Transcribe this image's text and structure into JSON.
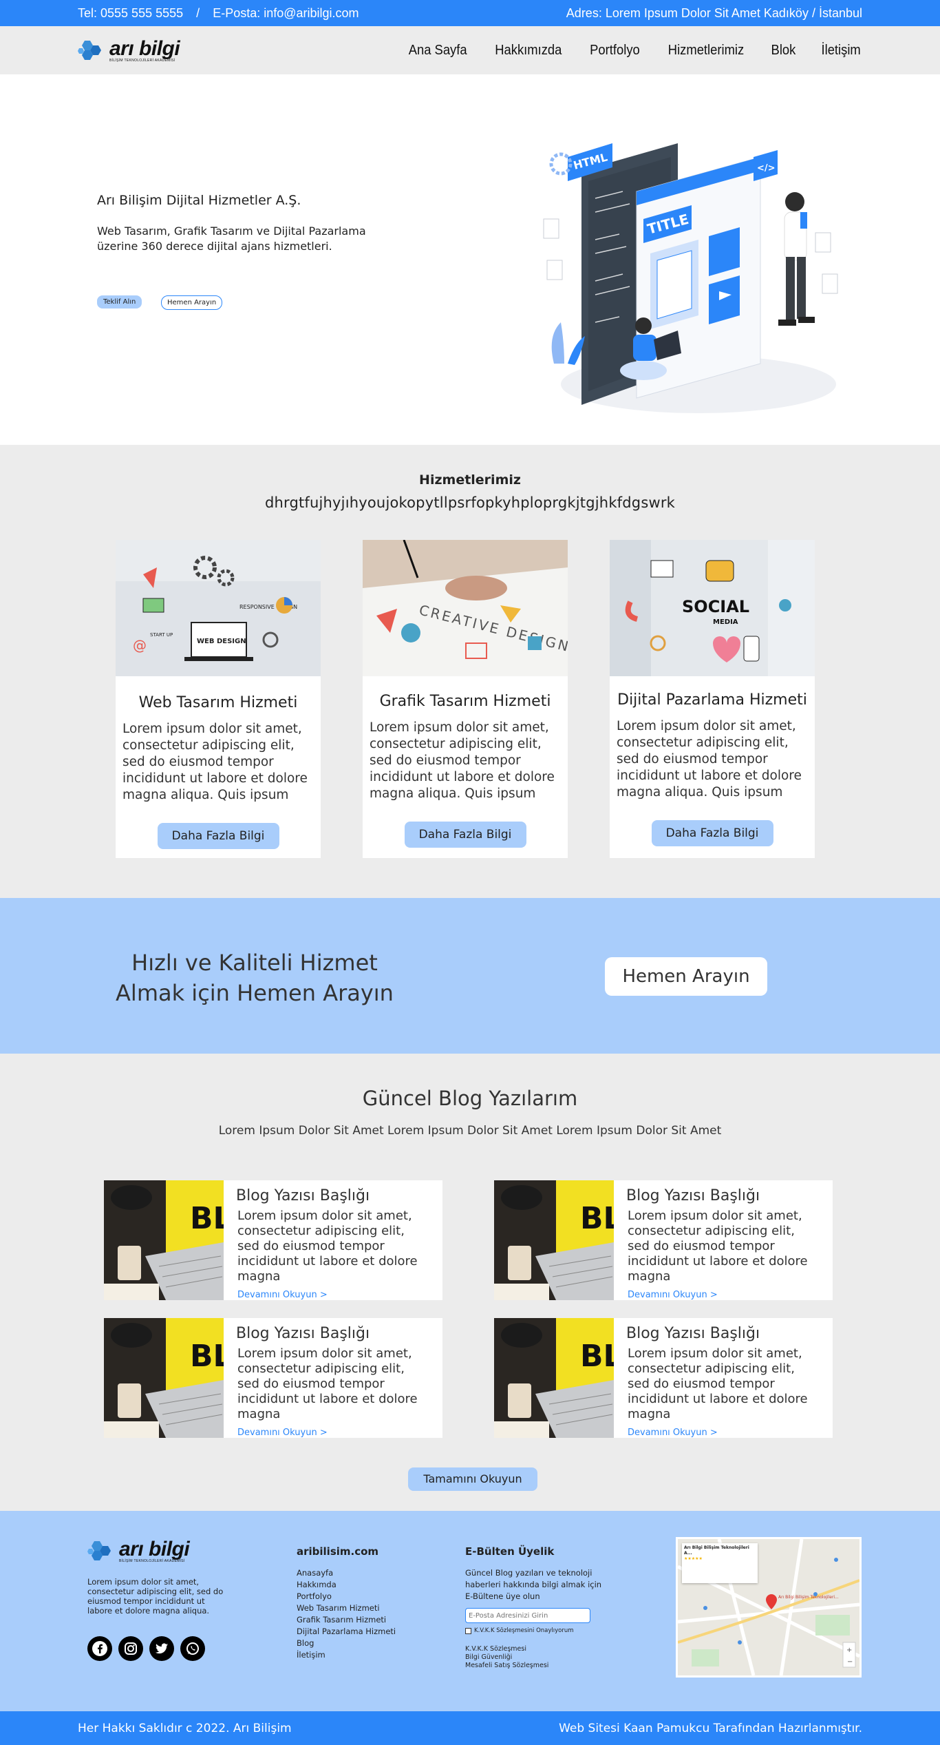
{
  "topbar": {
    "phone": "Tel: 0555 555 5555",
    "separator": "/",
    "email": "E-Posta: info@aribilgi.com",
    "address": "Adres: Lorem Ipsum Dolor Sit Amet Kadıköy / İstanbul"
  },
  "logo": {
    "name": "arı bilgi",
    "tagline": "BİLİŞİM TEKNOLOJİLERİ AKADEMİSİ"
  },
  "nav": {
    "items": [
      "Ana Sayfa",
      "Hakkımızda",
      "Portfolyo",
      "Hizmetlerimiz",
      "Blok",
      "İletişim"
    ]
  },
  "hero": {
    "title": "Arı Bilişim Dijital Hizmetler A.Ş.",
    "description": "Web Tasarım, Grafik Tasarım ve Dijital Pazarlama üzerine 360 derece dijital ajans hizmetleri.",
    "btn_quote": "Teklif Alın",
    "btn_call": "Hemen Arayın",
    "illustration_labels": {
      "html": "HTML",
      "title": "TITLE",
      "code": "</>"
    }
  },
  "services": {
    "title": "Hizmetlerimiz",
    "subtitle": "dhrgtfujhyjıhyoujokopytllpsrfopkyhploprgkjtgjhkfdgswrk",
    "cards": [
      {
        "title": "Web Tasarım Hizmeti",
        "text": "Lorem ipsum dolor sit amet, consectetur adipiscing elit, sed do eiusmod tempor incididunt ut labore et dolore magna aliqua. Quis ipsum",
        "button": "Daha Fazla Bilgi",
        "image_labels": [
          "RESPONSIVE DESIGN",
          "WEB DESIGN",
          "START UP"
        ]
      },
      {
        "title": "Grafik Tasarım Hizmeti",
        "text": "Lorem ipsum dolor sit amet, consectetur adipiscing elit, sed do eiusmod tempor incididunt ut labore et dolore magna aliqua. Quis ipsum",
        "button": "Daha Fazla Bilgi",
        "image_labels": [
          "CREATIVE DESIGN"
        ]
      },
      {
        "title": "Dijital Pazarlama Hizmeti",
        "text": "Lorem ipsum dolor sit amet, consectetur adipiscing elit, sed do eiusmod tempor incididunt ut labore et dolore magna aliqua. Quis ipsum",
        "button": "Daha Fazla Bilgi",
        "image_labels": [
          "SOCIAL",
          "MEDIA"
        ]
      }
    ]
  },
  "cta": {
    "text": "Hızlı ve Kaliteli Hizmet Almak için Hemen Arayın",
    "button": "Hemen Arayın"
  },
  "blog": {
    "title": "Güncel Blog Yazılarım",
    "subtitle": "Lorem Ipsum Dolor Sit Amet Lorem Ipsum Dolor Sit Amet Lorem Ipsum Dolor Sit Amet",
    "posts": [
      {
        "title": "Blog Yazısı Başlığı",
        "text": "Lorem ipsum dolor sit amet, consectetur adipiscing elit, sed do eiusmod tempor incididunt ut labore et dolore magna",
        "link": "Devamını Okuyun >",
        "image_label": "BL"
      },
      {
        "title": "Blog Yazısı Başlığı",
        "text": "Lorem ipsum dolor sit amet, consectetur adipiscing elit, sed do eiusmod tempor incididunt ut labore et dolore magna",
        "link": "Devamını Okuyun >",
        "image_label": "BL"
      },
      {
        "title": "Blog Yazısı Başlığı",
        "text": "Lorem ipsum dolor sit amet, consectetur adipiscing elit, sed do eiusmod tempor incididunt ut labore et dolore magna",
        "link": "Devamını Okuyun >",
        "image_label": "BL"
      },
      {
        "title": "Blog Yazısı Başlığı",
        "text": "Lorem ipsum dolor sit amet, consectetur adipiscing elit, sed do eiusmod tempor incididunt ut labore et dolore magna",
        "link": "Devamını Okuyun >",
        "image_label": "BL"
      }
    ],
    "read_all": "Tamamını Okuyun"
  },
  "footer": {
    "description": "Lorem ipsum dolor sit amet, consectetur adipiscing elit, sed do eiusmod tempor incididunt ut labore et dolore magna aliqua.",
    "social": [
      "facebook-icon",
      "instagram-icon",
      "twitter-icon",
      "whatsapp-icon"
    ],
    "links_title": "aribilisim.com",
    "links": [
      "Anasayfa",
      "Hakkımda",
      "Portfolyo",
      "Web Tasarım Hizmeti",
      "Grafik Tasarım Hizmeti",
      "Dijital Pazarlama Hizmeti",
      "Blog",
      "İletişim"
    ],
    "newsletter_title": "E-Bülten Üyelik",
    "newsletter_desc": "Güncel Blog yazıları ve teknoloji haberleri hakkında bilgi almak için E-Bültene üye olun",
    "email_placeholder": "E-Posta Adresinizi Girin",
    "kvkk_consent": "K.V.K.K Sözleşmesini Onaylıyorum",
    "legal": [
      "K.V.K.K Sözleşmesi",
      "Bilgi Güvenliği",
      "Mesafeli Satış Sözleşmesi"
    ],
    "map_place": "Arı Bilgi Bilişim Teknolojileri A...",
    "map_marker": "Arı Bilgi Bilişim Teknolojileri..."
  },
  "bottom": {
    "copyright": "Her Hakkı Saklıdır c 2022. Arı Bilişim",
    "credit": "Web Sitesi Kaan Pamukcu Tarafından Hazırlanmıştır."
  },
  "colors": {
    "primary": "#2b86f9",
    "light": "#a9cdfb",
    "gray": "#ececec"
  }
}
